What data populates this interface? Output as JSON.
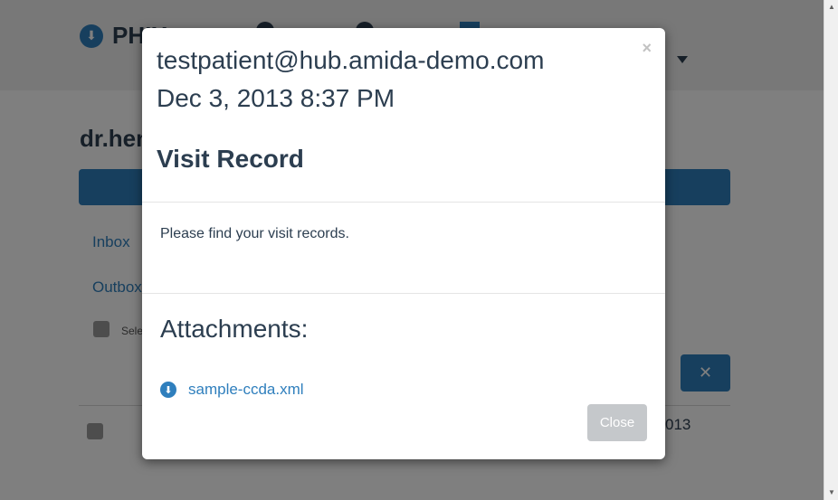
{
  "header": {
    "brand": "PHIX"
  },
  "page": {
    "username": "dr.hen",
    "nav_links": [
      "Inbox",
      "Outbox"
    ],
    "select_label": "Sele",
    "delete_icon": "close-x-icon",
    "row_year": "013"
  },
  "modal": {
    "sender": "testpatient@hub.amida-demo.com",
    "date": "Dec 3, 2013 8:37 PM",
    "subject": "Visit Record",
    "body": "Please find your visit records.",
    "attachments_heading": "Attachments:",
    "attachments": [
      {
        "name": "sample-ccda.xml",
        "icon": "download-circle-icon"
      }
    ],
    "close_x": "×",
    "close_label": "Close"
  },
  "colors": {
    "primary": "#2f7fbd",
    "text": "#2c3e50",
    "disabled_button": "#c5c8cb",
    "backdrop": "rgba(0,0,0,0.5)"
  }
}
